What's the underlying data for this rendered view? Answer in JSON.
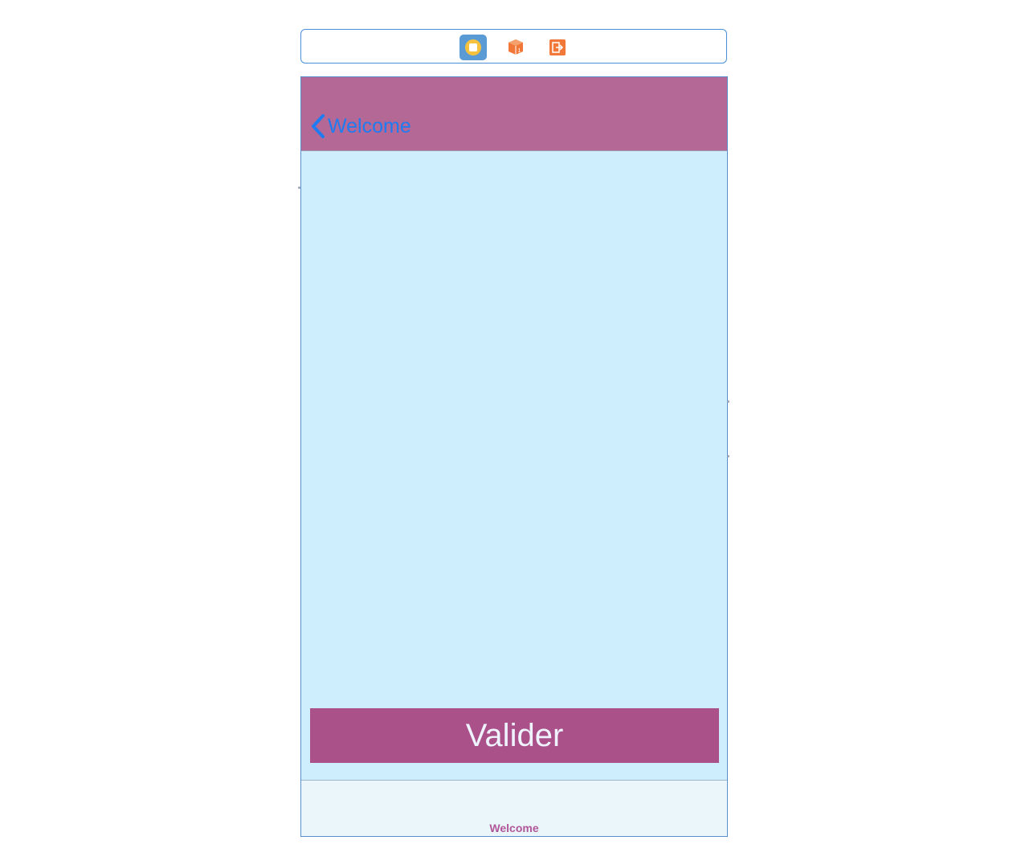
{
  "scene_dock": {
    "icons": [
      {
        "name": "view-controller-icon",
        "color": "#5b9bd5"
      },
      {
        "name": "first-responder-icon",
        "color": "#f2783a"
      },
      {
        "name": "exit-icon",
        "color": "#f2783a"
      }
    ]
  },
  "navbar": {
    "background": "#b46896",
    "back_label": "Welcome",
    "tint": "#1e7bf2"
  },
  "content": {
    "background": "#cfeefd"
  },
  "primary_button": {
    "label": "Valider",
    "background": "#ab5189"
  },
  "tabbar": {
    "items": [
      {
        "label": "Welcome",
        "color": "#b0579a"
      }
    ]
  }
}
